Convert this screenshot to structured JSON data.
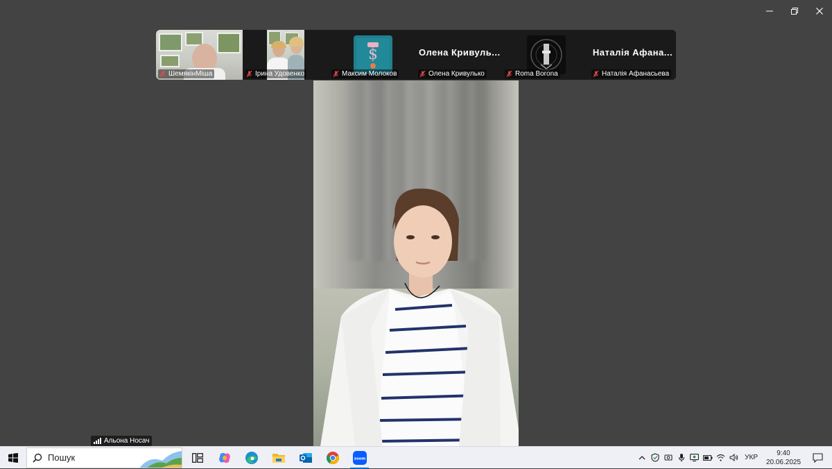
{
  "window": {
    "minimize": "minimize",
    "restore": "restore",
    "close": "close"
  },
  "gallery": {
    "participants": [
      {
        "name": "ШемякінМіша",
        "display": "video"
      },
      {
        "name": "Ірина Удовенко",
        "display": "video"
      },
      {
        "name": "Максим Молоков",
        "display": "avatar"
      },
      {
        "name": "Олена Кривулько",
        "display": "name",
        "big_name": "Олена Кривуль..."
      },
      {
        "name": "Roma Borona",
        "display": "avatar"
      },
      {
        "name": "Наталія Афанасьева",
        "display": "name",
        "big_name": "Наталія Афана..."
      }
    ]
  },
  "speaker": {
    "name": "Альона Носач"
  },
  "taskbar": {
    "search_placeholder": "Пошук",
    "apps": [
      "task-view",
      "copilot",
      "edge",
      "file-explorer",
      "outlook",
      "chrome",
      "zoom"
    ],
    "active_app": "zoom",
    "language": "УКР",
    "time": "9:40",
    "date": "20.06.2025"
  },
  "colors": {
    "accent": "#0b5cff",
    "muted_icon": "#e5484d",
    "taskbar": "#eef0f5"
  }
}
